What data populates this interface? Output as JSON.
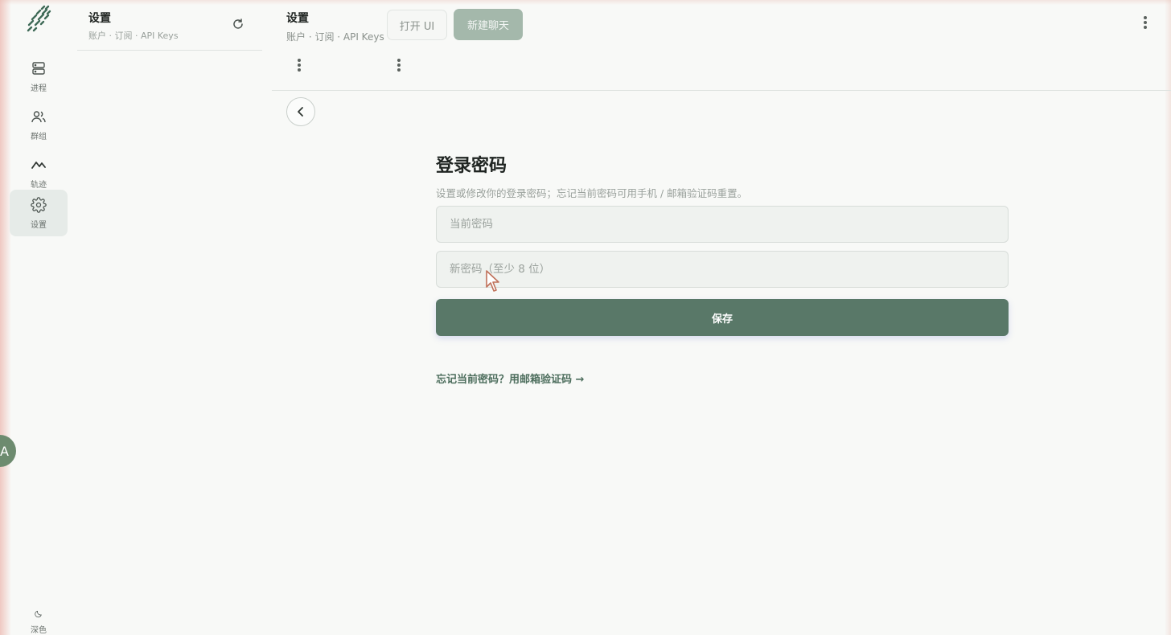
{
  "rail": {
    "items": [
      {
        "label": "进程",
        "icon": "server-icon"
      },
      {
        "label": "群组",
        "icon": "users-icon"
      },
      {
        "label": "轨迹",
        "icon": "trend-icon"
      },
      {
        "label": "设置",
        "icon": "gear-icon",
        "active": true
      }
    ],
    "avatar_initial": "A",
    "theme_label": "深色"
  },
  "list": {
    "title": "设置",
    "subtitle": "账户 · 订阅 · API Keys"
  },
  "header": {
    "title": "设置",
    "subtitle": "账户 · 订阅 · API Keys",
    "open_ui_label": "打开 UI",
    "new_chat_label": "新建聊天"
  },
  "form": {
    "title": "登录密码",
    "description": "设置或修改你的登录密码；忘记当前密码可用手机 / 邮箱验证码重置。",
    "current_password_placeholder": "当前密码",
    "new_password_placeholder": "新密码（至少 8 位）",
    "save_label": "保存",
    "forgot_link": "忘记当前密码？用邮箱验证码 →"
  },
  "colors": {
    "accent": "#597868",
    "new_chat_bg": "#a4b8ab",
    "active_nav_bg": "#e6ebe8"
  }
}
